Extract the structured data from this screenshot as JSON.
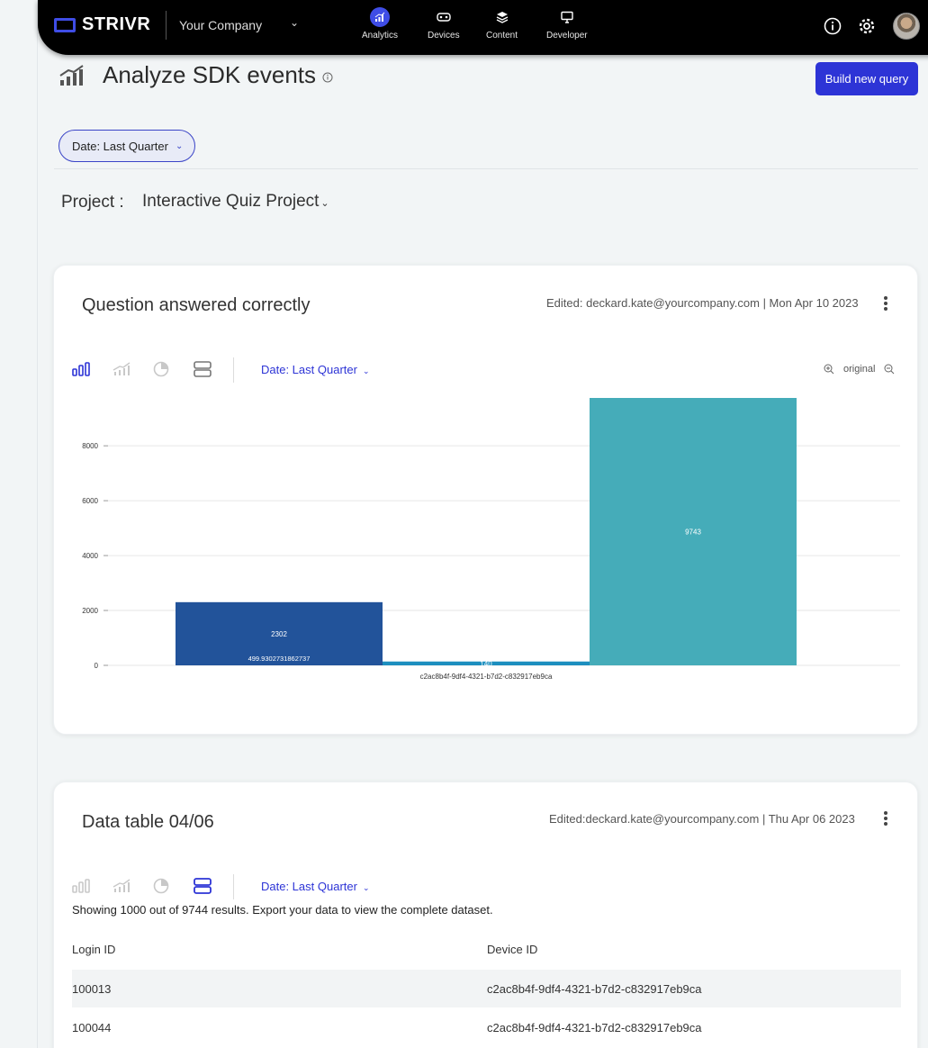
{
  "topbar": {
    "logo_text": "STRIVR",
    "company": "Your Company",
    "nav": [
      {
        "label": "Analytics",
        "active": true
      },
      {
        "label": "Devices",
        "active": false
      },
      {
        "label": "Content",
        "active": false
      },
      {
        "label": "Developer",
        "active": false
      }
    ]
  },
  "page": {
    "title": "Analyze SDK events",
    "build_button": "Build new query",
    "date_filter": "Date: Last Quarter",
    "project_label": "Project :",
    "project_value": "Interactive Quiz Project"
  },
  "chart_card": {
    "title": "Question answered correctly",
    "edited": "Edited: deckard.kate@yourcompany.com | Mon Apr 10 2023",
    "date_filter": "Date: Last Quarter",
    "zoom_label": "original"
  },
  "chart_data": {
    "type": "bar",
    "x": [
      "c2ac8b4f-9df4-4321-b7d2-c832917eb9ca"
    ],
    "series": [
      {
        "value": 2302,
        "sub_label": "499.9302731862737",
        "color": "#22539a"
      },
      {
        "value": 140,
        "color": "#1c8fbf"
      },
      {
        "value": 9743,
        "color": "#45acb9"
      }
    ],
    "yticks": [
      0,
      2000,
      4000,
      6000,
      8000
    ],
    "ylim": [
      0,
      9743
    ],
    "grid": true
  },
  "table_card": {
    "title": "Data table 04/06",
    "edited": "Edited:deckard.kate@yourcompany.com  | Thu Apr 06 2023",
    "date_filter": "Date: Last Quarter",
    "note": "Showing 1000 out of 9744 results. Export your data to view the complete dataset.",
    "columns": [
      "Login ID",
      "Device ID"
    ],
    "rows": [
      [
        "100013",
        "c2ac8b4f-9df4-4321-b7d2-c832917eb9ca"
      ],
      [
        "100044",
        "c2ac8b4f-9df4-4321-b7d2-c832917eb9ca"
      ]
    ]
  },
  "colors": {
    "accent": "#2d34d6",
    "topbar": "#000000"
  }
}
